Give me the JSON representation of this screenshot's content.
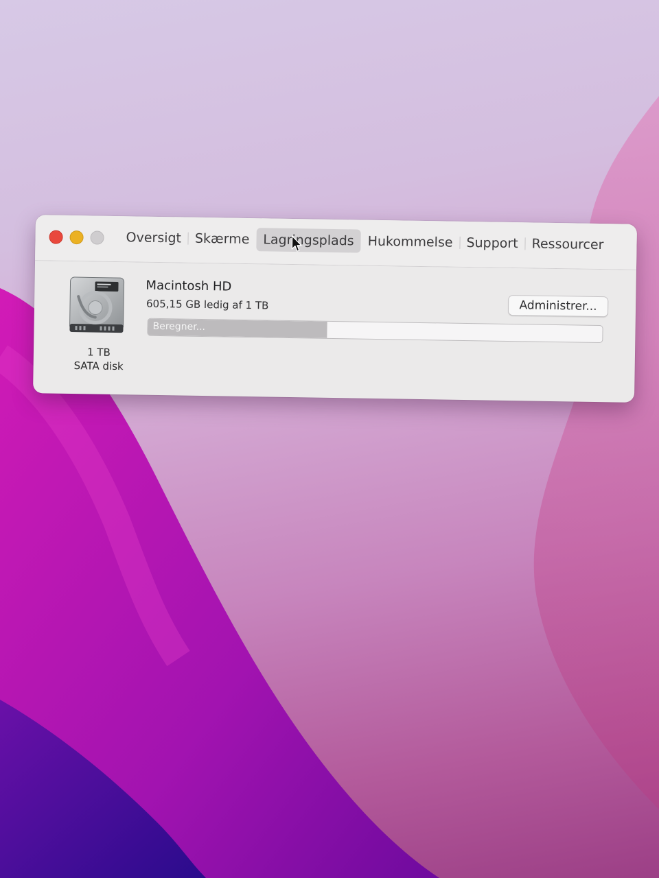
{
  "window": {
    "tabs": [
      {
        "label": "Oversigt"
      },
      {
        "label": "Skærme"
      },
      {
        "label": "Lagringsplads"
      },
      {
        "label": "Hukommelse"
      },
      {
        "label": "Support"
      },
      {
        "label": "Ressourcer"
      }
    ],
    "active_tab": "Lagringsplads"
  },
  "disk": {
    "icon": "hard-drive-icon",
    "size": "1 TB",
    "type": "SATA disk",
    "volume_name": "Macintosh HD",
    "free_text": "605,15 GB ledig af 1 TB",
    "manage_label": "Administrer...",
    "bar_status": "Beregner...",
    "bar_fill_fraction": 0.395
  },
  "colors": {
    "close": "#e9483c",
    "minimize": "#ebb123",
    "zoom": "#cfcdcf"
  }
}
